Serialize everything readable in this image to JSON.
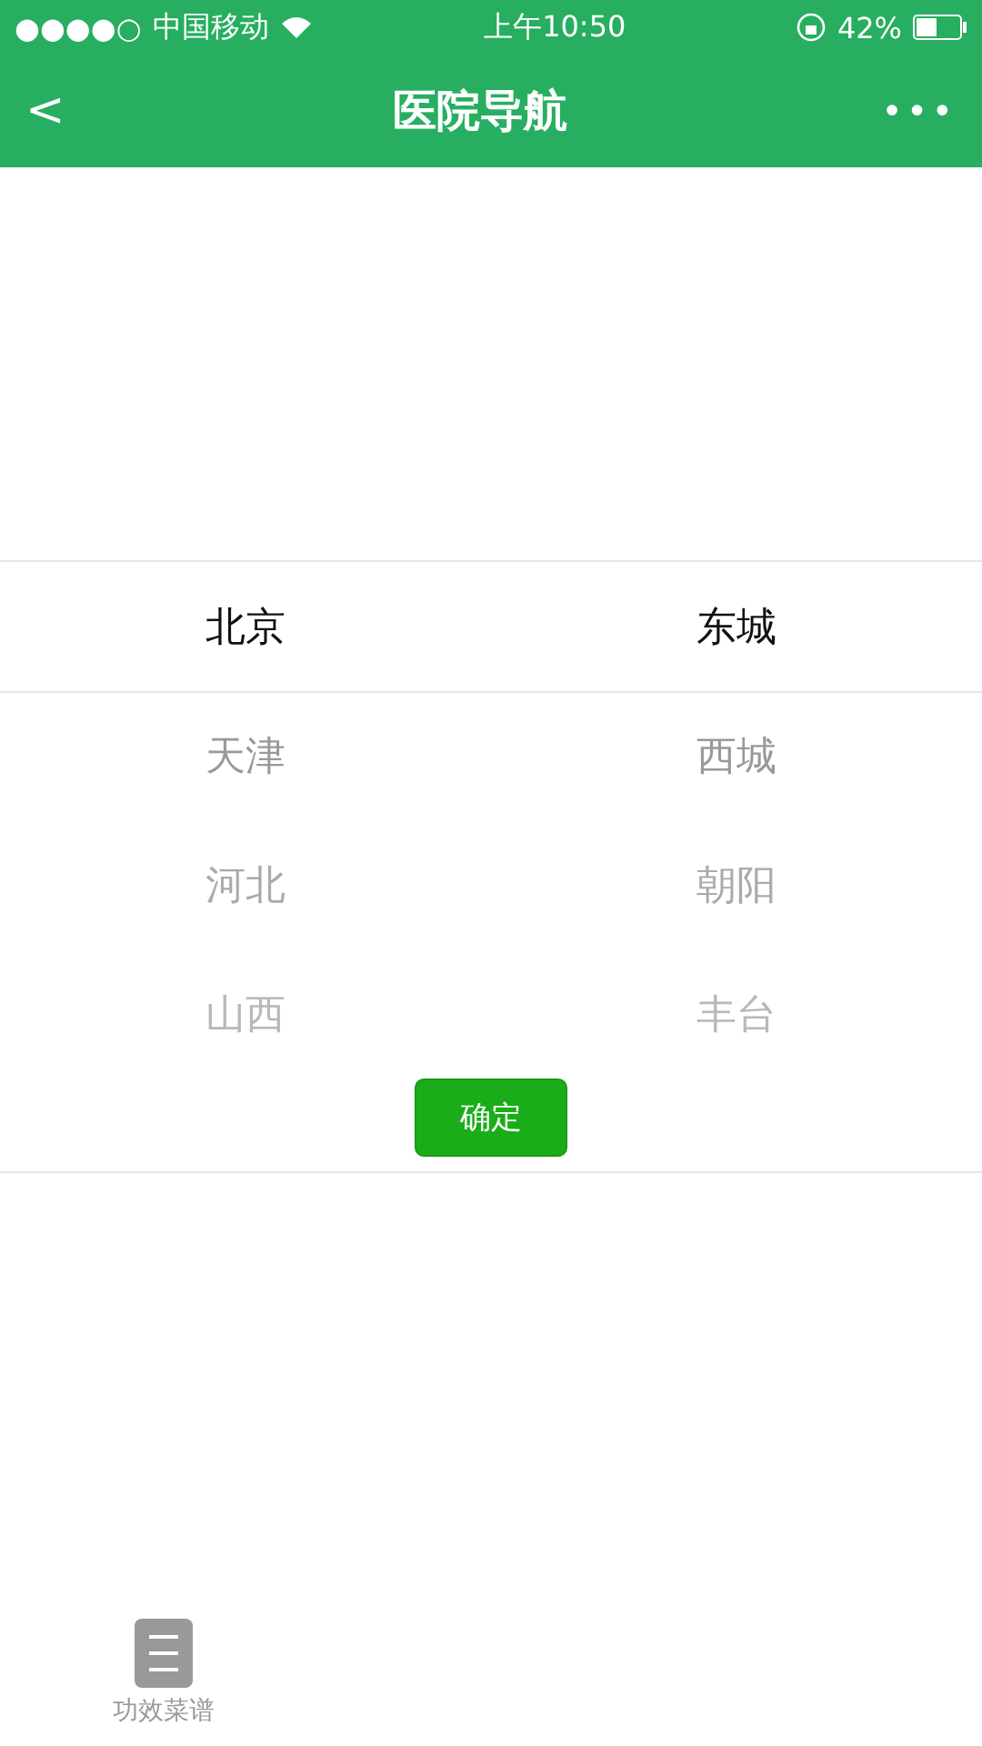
{
  "status_bar": {
    "signal": "●●●●○",
    "carrier": "中国移动",
    "time": "上午10:50",
    "battery": "42%"
  },
  "nav": {
    "back": "<",
    "title": "医院导航",
    "more": "•••"
  },
  "picker": {
    "columns": [
      {
        "items": [
          {
            "label": "北京",
            "selected": true
          },
          {
            "label": "天津",
            "selected": false
          },
          {
            "label": "河北",
            "selected": false
          },
          {
            "label": "山西",
            "selected": false
          }
        ]
      },
      {
        "items": [
          {
            "label": "东城",
            "selected": true
          },
          {
            "label": "西城",
            "selected": false
          },
          {
            "label": "朝阳",
            "selected": false
          },
          {
            "label": "丰台",
            "selected": false
          }
        ]
      }
    ],
    "confirm": "确定"
  },
  "tab_bar": {
    "items": [
      {
        "label": "功效菜谱",
        "selected": false
      }
    ]
  }
}
